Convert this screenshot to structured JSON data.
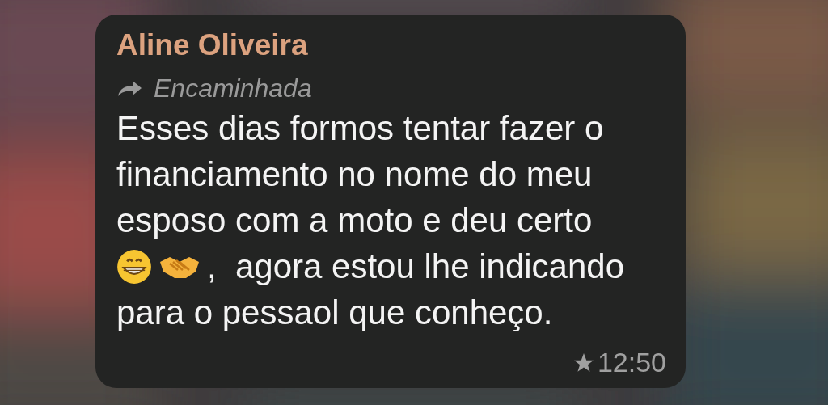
{
  "message": {
    "sender": "Aline Oliveira",
    "forwarded": {
      "label": "Encaminhada"
    },
    "lines": [
      [
        {
          "kind": "text",
          "text": "Esses dias formos tentar fazer o"
        }
      ],
      [
        {
          "kind": "text",
          "text": "financiamento no nome do meu"
        }
      ],
      [
        {
          "kind": "text",
          "text": "esposo com a moto e deu certo"
        }
      ],
      [
        {
          "kind": "grin"
        },
        {
          "kind": "handshake"
        },
        {
          "kind": "text",
          "text": ",  agora estou lhe indicando"
        }
      ],
      [
        {
          "kind": "text",
          "text": "para o pessaol que conheço."
        }
      ]
    ],
    "starred": true,
    "time": "12:50"
  }
}
